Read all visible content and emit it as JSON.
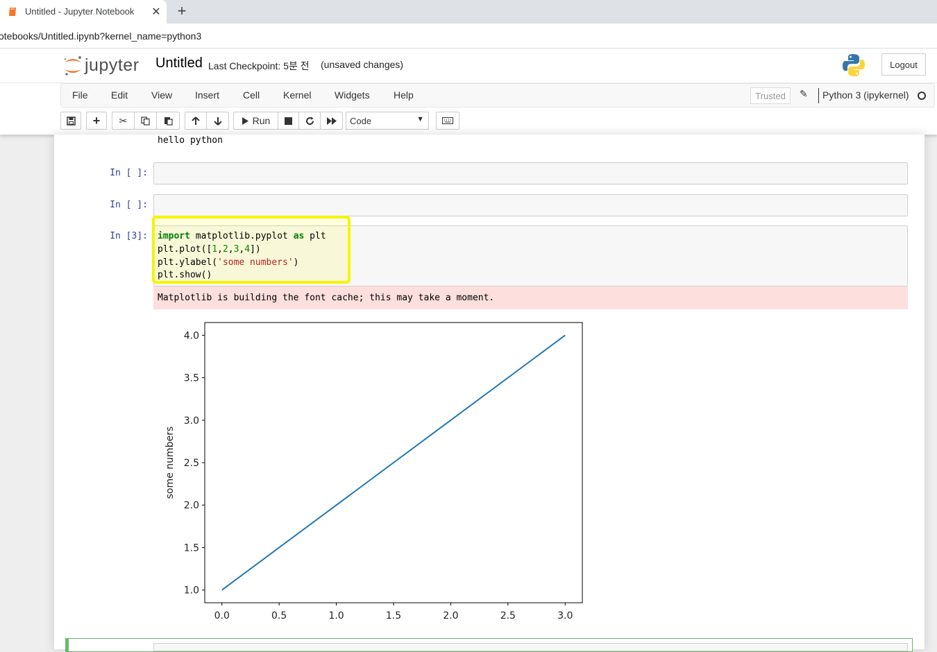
{
  "browser": {
    "tab_title": "Untitled - Jupyter Notebook",
    "address": "otebooks/Untitled.ipynb?kernel_name=python3"
  },
  "header": {
    "logo_text": "jupyter",
    "notebook_name": "Untitled",
    "checkpoint": "Last Checkpoint: 5분 전",
    "unsaved": "(unsaved changes)",
    "logout_label": "Logout"
  },
  "menubar": {
    "items": [
      "File",
      "Edit",
      "View",
      "Insert",
      "Cell",
      "Kernel",
      "Widgets",
      "Help"
    ],
    "trusted": "Trusted",
    "kernel_name": "Python 3 (ipykernel)"
  },
  "toolbar": {
    "run_label": "Run",
    "cell_type": "Code"
  },
  "cells": {
    "previous_output": "hello python",
    "empty_prompt": "In [ ]:",
    "code_prompt": "In [3]:",
    "code": {
      "line1_kw": "import",
      "line1_mod": " matplotlib.pyplot ",
      "line1_as": "as",
      "line1_alias": " plt",
      "line2_a": "plt.plot([",
      "line2_n1": "1",
      "line2_c1": ",",
      "line2_n2": "2",
      "line2_c2": ",",
      "line2_n3": "3",
      "line2_c3": ",",
      "line2_n4": "4",
      "line2_b": "])",
      "line3_a": "plt.ylabel(",
      "line3_str": "'some numbers'",
      "line3_b": ")",
      "line4": "plt.show()"
    },
    "stderr": "Matplotlib is building the font cache; this may take a moment."
  },
  "colors": {
    "prompt": "#303f9f",
    "highlight": "#f5f500",
    "stderr_bg": "#fddfdd",
    "line": "#1f77b4"
  },
  "chart_data": {
    "type": "line",
    "x": [
      0,
      1,
      2,
      3
    ],
    "series": [
      {
        "values": [
          1,
          2,
          3,
          4
        ]
      }
    ],
    "title": "",
    "xlabel": "",
    "ylabel": "some numbers",
    "xlim": [
      -0.15,
      3.15
    ],
    "ylim": [
      0.85,
      4.15
    ],
    "xticks": [
      "0.0",
      "0.5",
      "1.0",
      "1.5",
      "2.0",
      "2.5",
      "3.0"
    ],
    "yticks": [
      "1.0",
      "1.5",
      "2.0",
      "2.5",
      "3.0",
      "3.5",
      "4.0"
    ],
    "grid": false
  }
}
